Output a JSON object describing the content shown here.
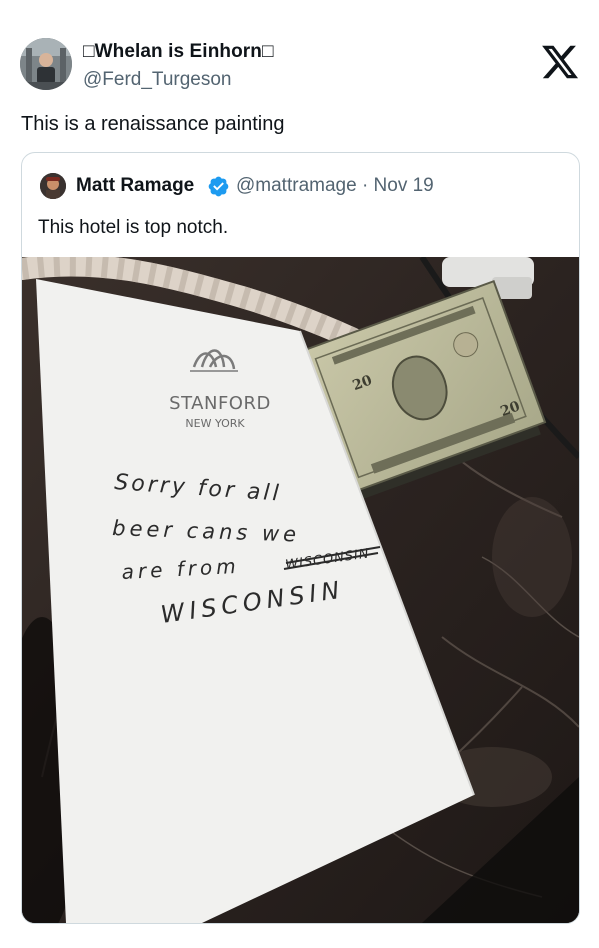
{
  "tweet": {
    "display_name": "□Whelan is Einhorn□",
    "handle": "@Ferd_Turgeson",
    "text": "This is a renaissance painting"
  },
  "quoted_tweet": {
    "author_name": "Matt Ramage",
    "author_handle_date": "@mattramage · Nov 19",
    "text": "This hotel is top notch."
  },
  "photo": {
    "logo_brand": "STANFORD",
    "logo_city": "NEW YORK",
    "note_lines": [
      "Sorry for all",
      "beer cans we",
      "are from",
      "WISCONSIN"
    ],
    "note_crossed_out": "WISCONSIN"
  },
  "icons": {
    "platform": "x-logo-icon",
    "verified": "verified-badge-icon"
  },
  "colors": {
    "text": "#0f1419",
    "secondary_text": "#536471",
    "border": "#cfd9de",
    "verified": "#1d9bf0"
  }
}
